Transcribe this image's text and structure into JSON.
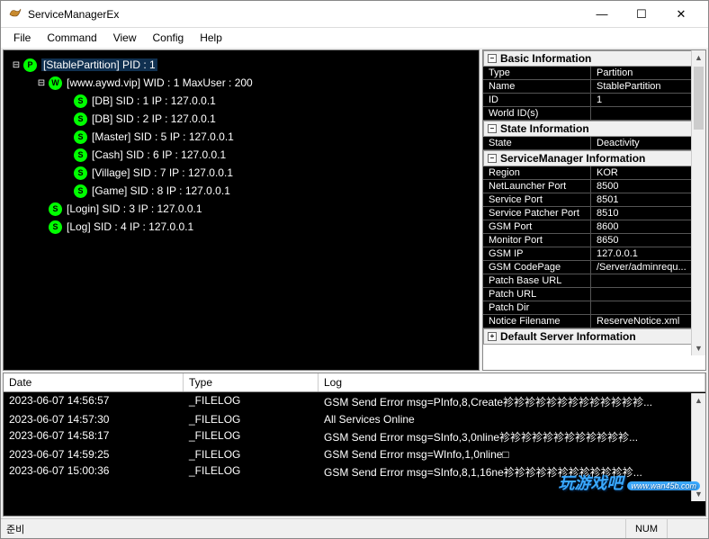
{
  "window": {
    "title": "ServiceManagerEx"
  },
  "menu": [
    "File",
    "Command",
    "View",
    "Config",
    "Help"
  ],
  "tree": [
    {
      "depth": 0,
      "exp": "⊟",
      "badge": "P",
      "label": "[StablePartition] PID : 1",
      "sel": true
    },
    {
      "depth": 1,
      "exp": "⊟",
      "badge": "W",
      "label": "[www.aywd.vip] WID : 1 MaxUser : 200"
    },
    {
      "depth": 2,
      "exp": "",
      "badge": "S",
      "label": "[DB] SID : 1 IP : 127.0.0.1"
    },
    {
      "depth": 2,
      "exp": "",
      "badge": "S",
      "label": "[DB] SID : 2 IP : 127.0.0.1"
    },
    {
      "depth": 2,
      "exp": "",
      "badge": "S",
      "label": "[Master] SID : 5 IP : 127.0.0.1"
    },
    {
      "depth": 2,
      "exp": "",
      "badge": "S",
      "label": "[Cash] SID : 6 IP : 127.0.0.1"
    },
    {
      "depth": 2,
      "exp": "",
      "badge": "S",
      "label": "[Village] SID : 7 IP : 127.0.0.1"
    },
    {
      "depth": 2,
      "exp": "",
      "badge": "S",
      "label": "[Game] SID : 8 IP : 127.0.0.1"
    },
    {
      "depth": 1,
      "exp": "",
      "badge": "S",
      "label": "[Login] SID : 3 IP : 127.0.0.1"
    },
    {
      "depth": 1,
      "exp": "",
      "badge": "S",
      "label": "[Log] SID : 4 IP : 127.0.0.1"
    }
  ],
  "info": {
    "basic": {
      "title": "Basic Information",
      "rows": [
        {
          "k": "Type",
          "v": "Partition"
        },
        {
          "k": "Name",
          "v": "StablePartition"
        },
        {
          "k": "ID",
          "v": "1"
        },
        {
          "k": "World ID(s)",
          "v": ""
        }
      ]
    },
    "state": {
      "title": "State Information",
      "rows": [
        {
          "k": "State",
          "v": "Deactivity"
        }
      ]
    },
    "sm": {
      "title": "ServiceManager Information",
      "rows": [
        {
          "k": "Region",
          "v": "KOR"
        },
        {
          "k": "NetLauncher Port",
          "v": "8500"
        },
        {
          "k": "Service Port",
          "v": "8501"
        },
        {
          "k": "Service Patcher Port",
          "v": "8510"
        },
        {
          "k": "GSM Port",
          "v": "8600"
        },
        {
          "k": "Monitor Port",
          "v": "8650"
        },
        {
          "k": "GSM IP",
          "v": "127.0.0.1"
        },
        {
          "k": "GSM CodePage",
          "v": "/Server/adminrequ..."
        },
        {
          "k": "Patch Base URL",
          "v": ""
        },
        {
          "k": "Patch URL",
          "v": ""
        },
        {
          "k": "Patch Dir",
          "v": ""
        },
        {
          "k": "Notice Filename",
          "v": "ReserveNotice.xml"
        }
      ]
    },
    "default": {
      "title": "Default Server Information"
    }
  },
  "log": {
    "headers": {
      "date": "Date",
      "type": "Type",
      "log": "Log"
    },
    "rows": [
      {
        "date": "2023-06-07 14:56:57",
        "type": "_FILELOG",
        "log": "GSM Send Error msg=PInfo,8,Create袗袗袗袗袗袗袗袗袗袗袗袗袗..."
      },
      {
        "date": "2023-06-07 14:57:30",
        "type": "_FILELOG",
        "log": "All Services Online"
      },
      {
        "date": "2023-06-07 14:58:17",
        "type": "_FILELOG",
        "log": "GSM Send Error msg=SInfo,3,0nline袗袗袗袗袗袗袗袗袗袗袗袗..."
      },
      {
        "date": "2023-06-07 14:59:25",
        "type": "_FILELOG",
        "log": "GSM Send Error msg=WInfo,1,0nline□"
      },
      {
        "date": "2023-06-07 15:00:36",
        "type": "_FILELOG",
        "log": "GSM Send Error msg=SInfo,8,1,16ne袗袗袗袗袗袗袗袗袗袗袗袗..."
      }
    ]
  },
  "status": {
    "ready": "준비",
    "num": "NUM"
  },
  "watermark": {
    "big": "玩游戏吧",
    "url": "www.wan45b.com"
  }
}
